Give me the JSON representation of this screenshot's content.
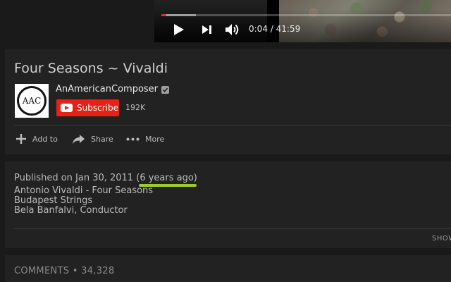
{
  "player": {
    "current_time": "0:04",
    "separator": "/",
    "duration": "41:59",
    "progress_played": 0.016,
    "progress_loaded": 0.12,
    "icons": {
      "play": "play-icon",
      "next": "next-icon",
      "volume": "volume-icon"
    }
  },
  "video": {
    "title": "Four Seasons ~ Vivaldi"
  },
  "channel": {
    "name": "AnAmericanComposer",
    "avatar_text": "AAC",
    "verified": true,
    "subscribe_label": "Subscribe",
    "subscriber_count": "192K"
  },
  "actions": [
    {
      "label": "Add to",
      "icon": "plus-icon"
    },
    {
      "label": "Share",
      "icon": "share-icon"
    },
    {
      "label": "More",
      "icon": "more-dots-icon"
    }
  ],
  "description": {
    "published_prefix": "Published on Jan 30, 2011 (",
    "published_relative": "6 years ago",
    "published_suffix": ")",
    "lines": [
      "Antonio Vivaldi - Four Seasons",
      "Budapest Strings",
      "Bela Banfalvi, Conductor"
    ],
    "show_more": "SHOW"
  },
  "comments": {
    "label": "COMMENTS",
    "bullet": "•",
    "count": "34,328"
  },
  "colors": {
    "accent_red": "#e62117",
    "progress_red": "#e52d27",
    "highlight_green": "#9ccc1c",
    "card_bg": "#222222",
    "page_bg": "#1a1a1a"
  }
}
